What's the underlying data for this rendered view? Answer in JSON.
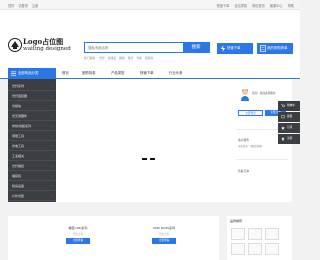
{
  "topbar": {
    "left": [
      "您好",
      "请登录",
      "注册"
    ],
    "right": [
      "快速下单",
      "全站导航",
      "网站首页",
      "客服中心",
      "帮助"
    ]
  },
  "logo": {
    "title": "Logo占位图",
    "subtitle": "waiting designed"
  },
  "search": {
    "placeholder": "搜索/商品名称",
    "button": "搜索"
  },
  "hotwords": [
    "热门搜索:",
    "光纤",
    "接线盒",
    "跳线",
    "尾纤",
    "光缆",
    "配线架"
  ],
  "quick_buttons": [
    "快速下单",
    "我的采购清单"
  ],
  "nav": {
    "all_label": "全部商品分类",
    "tabs": [
      "首页",
      "团购特惠",
      "产品类型",
      "快速下单",
      "行业头条"
    ]
  },
  "sidebar": {
    "items": [
      "光纤系列",
      "光纤连接器",
      "光模块",
      "光无源器件",
      "布线/线缆系列",
      "测量工具",
      "光电工具",
      "工业相关",
      "光纤熔接",
      "熔接机",
      "机房设备",
      "户外光缆",
      "其他产品"
    ]
  },
  "right_panel": {
    "welcome": "您好！欢迎来到我的",
    "login_button": "立即登录",
    "register_button": "免费注册",
    "service_title": "客户服务",
    "service_line": "电话咨询：请联系客服",
    "order_title": "查看订单"
  },
  "floatbar": [
    "购物车",
    "客服",
    "订阅",
    "顶部"
  ],
  "products": [
    {
      "name": "精密 LED系列",
      "sub": "开拓全新",
      "button": "立即查看"
    },
    {
      "name": "AMD DC05系列",
      "sub": "开拓全新",
      "button": "立即查看"
    }
  ],
  "news": {
    "title": "品牌推荐"
  },
  "colors": {
    "brand": "#2b78e4",
    "sidebar": "#3b3f44"
  }
}
